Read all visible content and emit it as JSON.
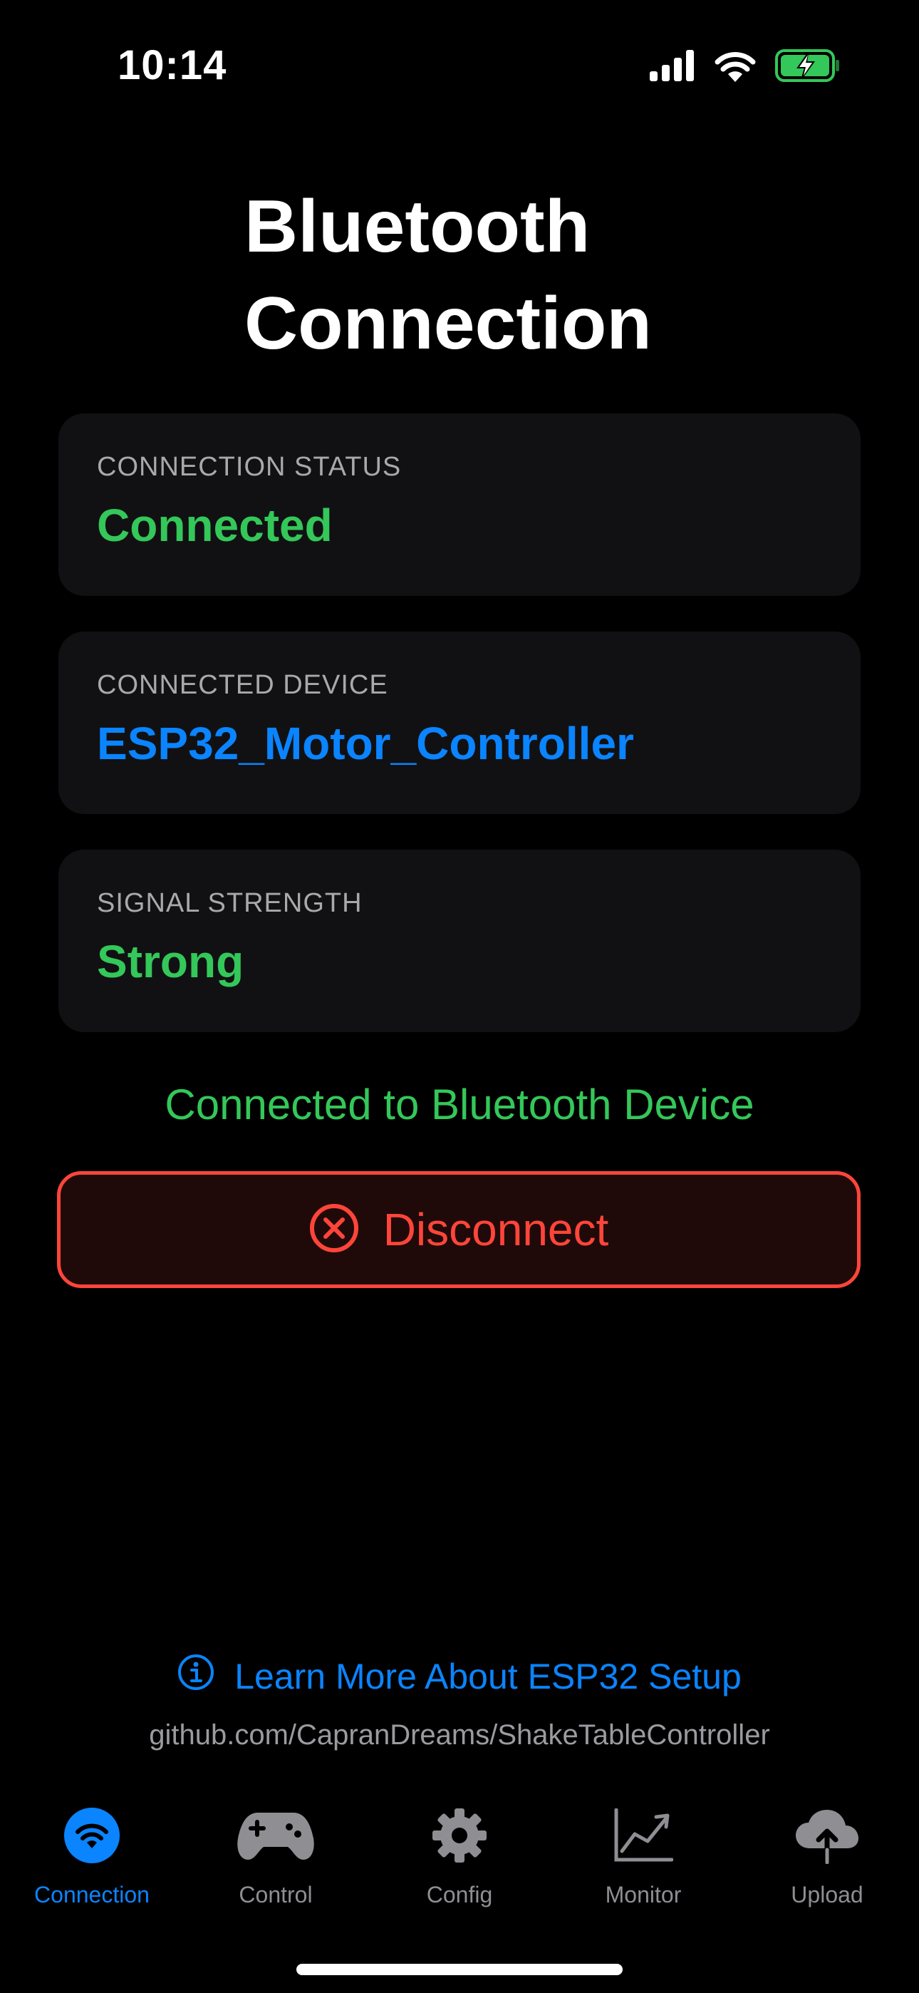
{
  "status_bar": {
    "time": "10:14"
  },
  "header": {
    "title": "Bluetooth Connection"
  },
  "cards": [
    {
      "label": "CONNECTION STATUS",
      "value": "Connected"
    },
    {
      "label": "CONNECTED DEVICE",
      "value": "ESP32_Motor_Controller"
    },
    {
      "label": "SIGNAL STRENGTH",
      "value": "Strong"
    }
  ],
  "status_message": "Connected to Bluetooth Device",
  "disconnect_button": {
    "label": "Disconnect",
    "icon": "x-circle-icon"
  },
  "footer": {
    "learn_more": "Learn More About ESP32 Setup",
    "github_url": "github.com/CapranDreams/ShakeTableController"
  },
  "tab_bar": {
    "tabs": [
      {
        "label": "Connection",
        "icon": "wifi-icon",
        "active": true
      },
      {
        "label": "Control",
        "icon": "gamepad-icon",
        "active": false
      },
      {
        "label": "Config",
        "icon": "gear-icon",
        "active": false
      },
      {
        "label": "Monitor",
        "icon": "chart-line-icon",
        "active": false
      },
      {
        "label": "Upload",
        "icon": "cloud-upload-icon",
        "active": false
      }
    ]
  },
  "colors": {
    "green": "#34c759",
    "blue": "#0a84ff",
    "red": "#ff453a",
    "inactive": "#8e8e93",
    "card_bg": "#111113"
  }
}
